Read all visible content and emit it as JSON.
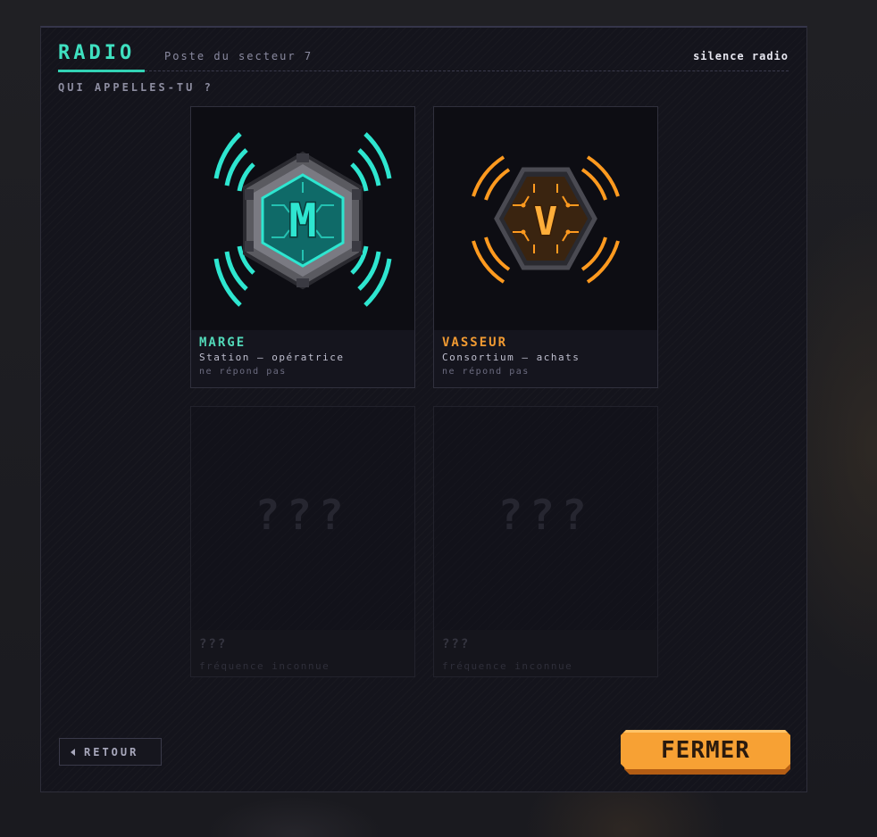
{
  "header": {
    "title": "RADIO",
    "subtitle": "Poste du secteur 7",
    "status": "silence radio"
  },
  "prompt": "QUI APPELLES-TU ?",
  "contacts": [
    {
      "name": "MARGE",
      "role": "Station — opératrice",
      "state": "ne répond pas",
      "emblem_letter": "M",
      "accent": "#2ee6d0"
    },
    {
      "name": "VASSEUR",
      "role": "Consortium — achats",
      "state": "ne répond pas",
      "emblem_letter": "V",
      "accent": "#ff9a1f"
    },
    {
      "name": "???",
      "placeholder": "???",
      "state": "fréquence inconnue"
    },
    {
      "name": "???",
      "placeholder": "???",
      "state": "fréquence inconnue"
    }
  ],
  "actions": {
    "back_label": "RETOUR",
    "close_label": "FERMER"
  },
  "colors": {
    "accent_teal": "#3fe0c0",
    "accent_orange": "#f7a134"
  }
}
